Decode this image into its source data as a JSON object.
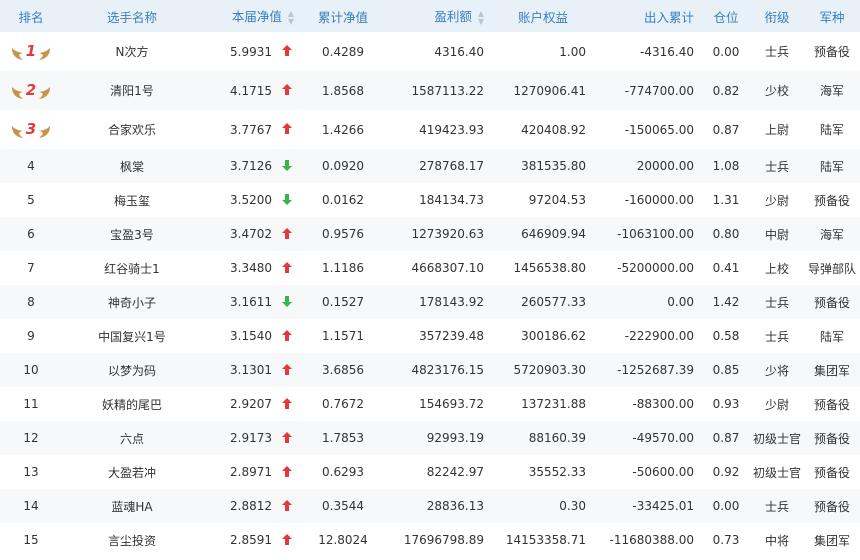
{
  "columns": [
    "排名",
    "选手名称",
    "本届净值",
    "累计净值",
    "盈利额",
    "账户权益",
    "出入累计",
    "仓位",
    "衔级",
    "军种"
  ],
  "sortable": [
    false,
    false,
    true,
    false,
    true,
    false,
    false,
    false,
    false,
    false
  ],
  "colors": {
    "header_bg": "#e9f1f8",
    "header_text": "#3a7fc1",
    "up": "#e4393c",
    "down": "#39b54a",
    "medal": "#c8924a"
  },
  "rows": [
    {
      "rank": "1",
      "medal": true,
      "name": "N次方",
      "nav": "5.9931",
      "trend": "up",
      "cum_nav": "0.4289",
      "profit": "4316.40",
      "equity": "1.00",
      "flow": "-4316.40",
      "position": "0.00",
      "rank_title": "士兵",
      "branch": "预备役"
    },
    {
      "rank": "2",
      "medal": true,
      "name": "清阳1号",
      "nav": "4.1715",
      "trend": "up",
      "cum_nav": "1.8568",
      "profit": "1587113.22",
      "equity": "1270906.41",
      "flow": "-774700.00",
      "position": "0.82",
      "rank_title": "少校",
      "branch": "海军"
    },
    {
      "rank": "3",
      "medal": true,
      "name": "合家欢乐",
      "nav": "3.7767",
      "trend": "up",
      "cum_nav": "1.4266",
      "profit": "419423.93",
      "equity": "420408.92",
      "flow": "-150065.00",
      "position": "0.87",
      "rank_title": "上尉",
      "branch": "陆军"
    },
    {
      "rank": "4",
      "medal": false,
      "name": "枫棠",
      "nav": "3.7126",
      "trend": "down",
      "cum_nav": "0.0920",
      "profit": "278768.17",
      "equity": "381535.80",
      "flow": "20000.00",
      "position": "1.08",
      "rank_title": "士兵",
      "branch": "陆军"
    },
    {
      "rank": "5",
      "medal": false,
      "name": "梅玉玺",
      "nav": "3.5200",
      "trend": "down",
      "cum_nav": "0.0162",
      "profit": "184134.73",
      "equity": "97204.53",
      "flow": "-160000.00",
      "position": "1.31",
      "rank_title": "少尉",
      "branch": "预备役"
    },
    {
      "rank": "6",
      "medal": false,
      "name": "宝盈3号",
      "nav": "3.4702",
      "trend": "up",
      "cum_nav": "0.9576",
      "profit": "1273920.63",
      "equity": "646909.94",
      "flow": "-1063100.00",
      "position": "0.80",
      "rank_title": "中尉",
      "branch": "海军"
    },
    {
      "rank": "7",
      "medal": false,
      "name": "红谷骑士1",
      "nav": "3.3480",
      "trend": "up",
      "cum_nav": "1.1186",
      "profit": "4668307.10",
      "equity": "1456538.80",
      "flow": "-5200000.00",
      "position": "0.41",
      "rank_title": "上校",
      "branch": "导弹部队"
    },
    {
      "rank": "8",
      "medal": false,
      "name": "神奇小子",
      "nav": "3.1611",
      "trend": "down",
      "cum_nav": "0.1527",
      "profit": "178143.92",
      "equity": "260577.33",
      "flow": "0.00",
      "position": "1.42",
      "rank_title": "士兵",
      "branch": "预备役"
    },
    {
      "rank": "9",
      "medal": false,
      "name": "中国复兴1号",
      "nav": "3.1540",
      "trend": "up",
      "cum_nav": "1.1571",
      "profit": "357239.48",
      "equity": "300186.62",
      "flow": "-222900.00",
      "position": "0.58",
      "rank_title": "士兵",
      "branch": "陆军"
    },
    {
      "rank": "10",
      "medal": false,
      "name": "以梦为码",
      "nav": "3.1301",
      "trend": "up",
      "cum_nav": "3.6856",
      "profit": "4823176.15",
      "equity": "5720903.30",
      "flow": "-1252687.39",
      "position": "0.85",
      "rank_title": "少将",
      "branch": "集团军"
    },
    {
      "rank": "11",
      "medal": false,
      "name": "妖精的尾巴",
      "nav": "2.9207",
      "trend": "up",
      "cum_nav": "0.7672",
      "profit": "154693.72",
      "equity": "137231.88",
      "flow": "-88300.00",
      "position": "0.93",
      "rank_title": "少尉",
      "branch": "预备役"
    },
    {
      "rank": "12",
      "medal": false,
      "name": "六点",
      "nav": "2.9173",
      "trend": "up",
      "cum_nav": "1.7853",
      "profit": "92993.19",
      "equity": "88160.39",
      "flow": "-49570.00",
      "position": "0.87",
      "rank_title": "初级士官",
      "branch": "预备役"
    },
    {
      "rank": "13",
      "medal": false,
      "name": "大盈若冲",
      "nav": "2.8971",
      "trend": "up",
      "cum_nav": "0.6293",
      "profit": "82242.97",
      "equity": "35552.33",
      "flow": "-50600.00",
      "position": "0.92",
      "rank_title": "初级士官",
      "branch": "预备役"
    },
    {
      "rank": "14",
      "medal": false,
      "name": "蓝魂HA",
      "nav": "2.8812",
      "trend": "up",
      "cum_nav": "0.3544",
      "profit": "28836.13",
      "equity": "0.30",
      "flow": "-33425.01",
      "position": "0.00",
      "rank_title": "士兵",
      "branch": "预备役"
    },
    {
      "rank": "15",
      "medal": false,
      "name": "言尘投资",
      "nav": "2.8591",
      "trend": "up",
      "cum_nav": "12.8024",
      "profit": "17696798.89",
      "equity": "14153358.71",
      "flow": "-11680388.00",
      "position": "0.73",
      "rank_title": "中将",
      "branch": "集团军"
    }
  ]
}
